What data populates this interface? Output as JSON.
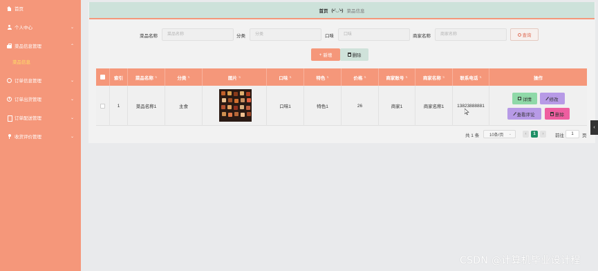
{
  "sidebar": {
    "items": [
      {
        "label": "首页",
        "icon": "home-icon",
        "expandable": false
      },
      {
        "label": "个人中心",
        "icon": "user-icon",
        "expandable": true
      },
      {
        "label": "菜品信息管理",
        "icon": "bag-icon",
        "expandable": true,
        "expanded": true
      },
      {
        "label": "菜品信息",
        "sub": true
      },
      {
        "label": "订单信息管理",
        "icon": "circle-icon",
        "expandable": true
      },
      {
        "label": "订单出货管理",
        "icon": "clock-icon",
        "expandable": true
      },
      {
        "label": "订单配送管理",
        "icon": "doc-icon",
        "expandable": true
      },
      {
        "label": "收货评价管理",
        "icon": "pin-icon",
        "expandable": true
      }
    ]
  },
  "breadcrumb": {
    "home": "首页",
    "face": "(•'◡'•)",
    "current": "菜品信息"
  },
  "search": {
    "fields": [
      {
        "label": "菜品名称",
        "placeholder": "菜品名称"
      },
      {
        "label": "分类",
        "placeholder": "分类"
      },
      {
        "label": "口味",
        "placeholder": "口味"
      },
      {
        "label": "商家名称",
        "placeholder": "商家名称"
      }
    ],
    "query_label": "查询"
  },
  "actions": {
    "add_label": "新增",
    "delete_label": "删除"
  },
  "table": {
    "headers": [
      "索引",
      "菜品名称",
      "分类",
      "图片",
      "口味",
      "特色",
      "价格",
      "商家账号",
      "商家名称",
      "联系电话",
      "操作"
    ],
    "rows": [
      {
        "index": "1",
        "name": "菜品名称1",
        "category": "主食",
        "taste": "口味1",
        "feature": "特色1",
        "price": "26",
        "merchant_account": "商家1",
        "merchant_name": "商家名称1",
        "phone": "13823888881"
      }
    ],
    "row_actions": {
      "detail": "详情",
      "edit": "修改",
      "review": "查看评论",
      "delete": "删除"
    }
  },
  "pagination": {
    "total": "共 1 条",
    "page_size": "10条/页",
    "current_page": "1",
    "goto_label": "前往",
    "goto_value": "1",
    "page_suffix": "页"
  },
  "watermark": "CSDN @计算机毕业设计程",
  "colors": {
    "sidebar": "#f5977a",
    "header": "#f5977a",
    "breadcrumb_bg": "#cde2da",
    "pagination_active": "#1e8f66",
    "detail_btn": "#8fd9a8",
    "edit_btn": "#b79ae6",
    "delete_btn": "#ee5ea0"
  }
}
